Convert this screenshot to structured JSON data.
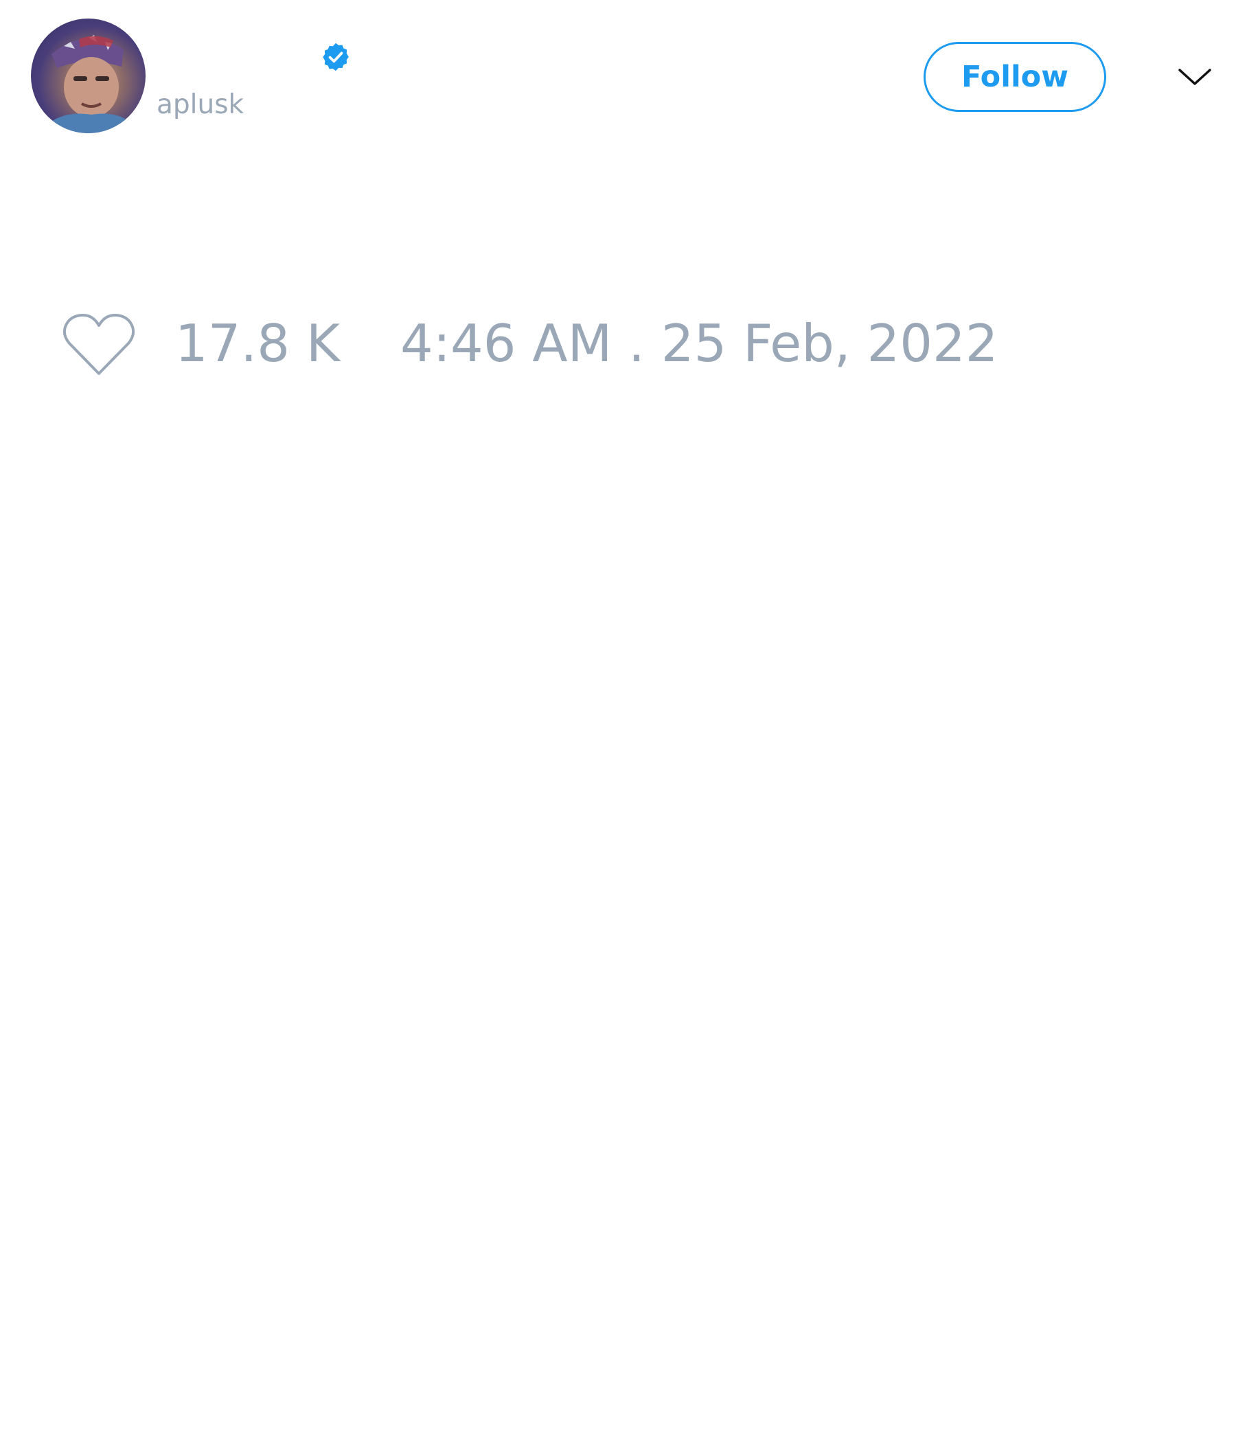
{
  "tweet": {
    "author": {
      "handle": "aplusk",
      "verified": true,
      "avatar_icon": "profile-photo"
    },
    "follow_button_label": "Follow",
    "more_icon": "chevron-down-icon",
    "like_icon": "heart-icon",
    "like_count": "17.8 K",
    "timestamp": "4:46 AM . 25 Feb, 2022"
  },
  "colors": {
    "accent": "#1d9bf0",
    "muted_text": "#9aa7b6",
    "background": "#ffffff"
  }
}
